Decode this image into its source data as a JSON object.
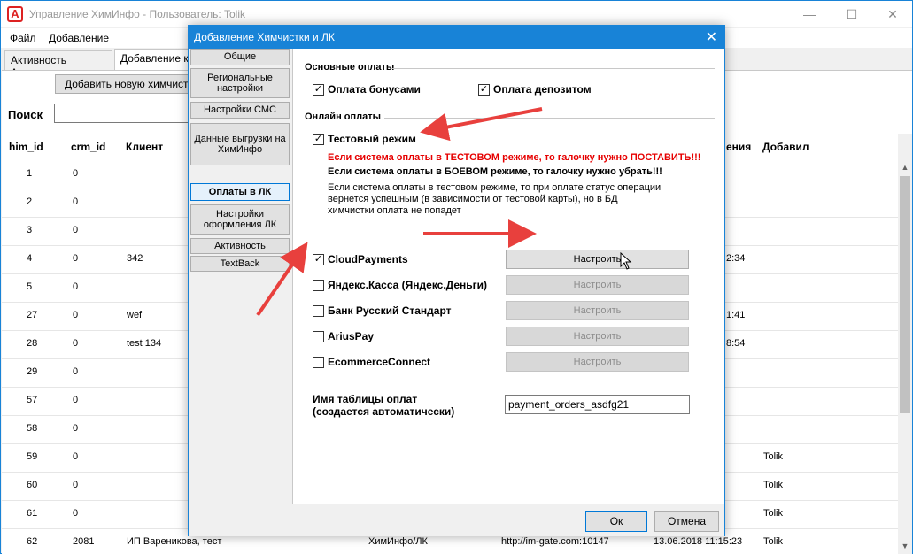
{
  "main": {
    "title": "Управление ХимИнфо - Пользователь: Tolik",
    "menu": [
      "Файл",
      "Добавление"
    ],
    "tabs": [
      "Активность Агентов",
      "Добавление к"
    ],
    "add_button": "Добавить новую химчистку",
    "search_label": "Поиск",
    "columns": {
      "him_id": "him_id",
      "crm_id": "crm_id",
      "client": "Клиент",
      "date_col": "ения",
      "added_by": "Добавил"
    },
    "rows": [
      {
        "him_id": "1",
        "crm_id": "0",
        "client": "",
        "extra": "",
        "date": "",
        "added": ""
      },
      {
        "him_id": "2",
        "crm_id": "0",
        "client": "",
        "extra": "",
        "date": "",
        "added": ""
      },
      {
        "him_id": "3",
        "crm_id": "0",
        "client": "",
        "extra": "",
        "date": "",
        "added": ""
      },
      {
        "him_id": "4",
        "crm_id": "0",
        "client": "342",
        "extra": "",
        "date": "2:34",
        "added": ""
      },
      {
        "him_id": "5",
        "crm_id": "0",
        "client": "",
        "extra": "",
        "date": "",
        "added": ""
      },
      {
        "him_id": "27",
        "crm_id": "0",
        "client": "wef",
        "extra": "",
        "date": "1:41",
        "added": ""
      },
      {
        "him_id": "28",
        "crm_id": "0",
        "client": "test 134",
        "extra": "",
        "date": "8:54",
        "added": ""
      },
      {
        "him_id": "29",
        "crm_id": "0",
        "client": "",
        "extra": "",
        "date": "",
        "added": ""
      },
      {
        "him_id": "57",
        "crm_id": "0",
        "client": "",
        "extra": "",
        "date": "",
        "added": ""
      },
      {
        "him_id": "58",
        "crm_id": "0",
        "client": "",
        "extra": "",
        "date": "",
        "added": ""
      },
      {
        "him_id": "59",
        "crm_id": "0",
        "client": "",
        "extra": "",
        "date": "",
        "added": "Tolik"
      },
      {
        "him_id": "60",
        "crm_id": "0",
        "client": "",
        "extra": "",
        "date": "",
        "added": "Tolik"
      },
      {
        "him_id": "61",
        "crm_id": "0",
        "client": "",
        "extra": "",
        "date": "",
        "added": "Tolik"
      },
      {
        "him_id": "62",
        "crm_id": "2081",
        "client": "ИП Вареникова, тест",
        "extra": "ХимИнфо/ЛК",
        "url": "http://im-gate.com:10147",
        "date": "13.06.2018 11:15:23",
        "added": "Tolik"
      }
    ]
  },
  "dialog": {
    "title": "Добавление Химчистки и ЛК",
    "sidebar": [
      "Общие",
      "Региональные настройки",
      "Настройки СМС",
      "Данные выгрузки на ХимИнфо",
      "Оплаты в ЛК",
      "Настройки оформления ЛК",
      "Активность",
      "TextBack"
    ],
    "active_sidebar_index": 4,
    "basic_payments_title": "Основные оплаты",
    "pay_bonus": "Оплата бонусами",
    "pay_deposit": "Оплата депозитом",
    "online_payments_title": "Онлайн оплаты",
    "test_mode": "Тестовый режим",
    "note_red": "Если система оплаты в ТЕСТОВОМ режиме, то галочку нужно ПОСТАВИТЬ!!!",
    "note_bold": "Если система оплаты в БОЕВОМ режиме, то галочку нужно убрать!!!",
    "note_plain": "Если система оплаты в тестовом режиме, то при оплате статус операции вернется успешным (в зависимости от тестовой карты), но в БД химчистки оплата не попадет",
    "providers": [
      {
        "name": "CloudPayments",
        "checked": true,
        "button": "Настроить",
        "enabled": true
      },
      {
        "name": "Яндекс.Касса (Яндекс.Деньги)",
        "checked": false,
        "button": "Настроить",
        "enabled": false
      },
      {
        "name": "Банк Русский Стандарт",
        "checked": false,
        "button": "Настроить",
        "enabled": false
      },
      {
        "name": "AriusPay",
        "checked": false,
        "button": "Настроить",
        "enabled": false
      },
      {
        "name": "EcommerceConnect",
        "checked": false,
        "button": "Настроить",
        "enabled": false
      }
    ],
    "table_label_1": "Имя таблицы оплат",
    "table_label_2": "(создается автоматически)",
    "table_value": "payment_orders_asdfg21",
    "ok": "Ок",
    "cancel": "Отмена"
  },
  "colors": {
    "accent": "#1883d7",
    "arrow": "#e8403d",
    "warning_text": "#e60000"
  }
}
